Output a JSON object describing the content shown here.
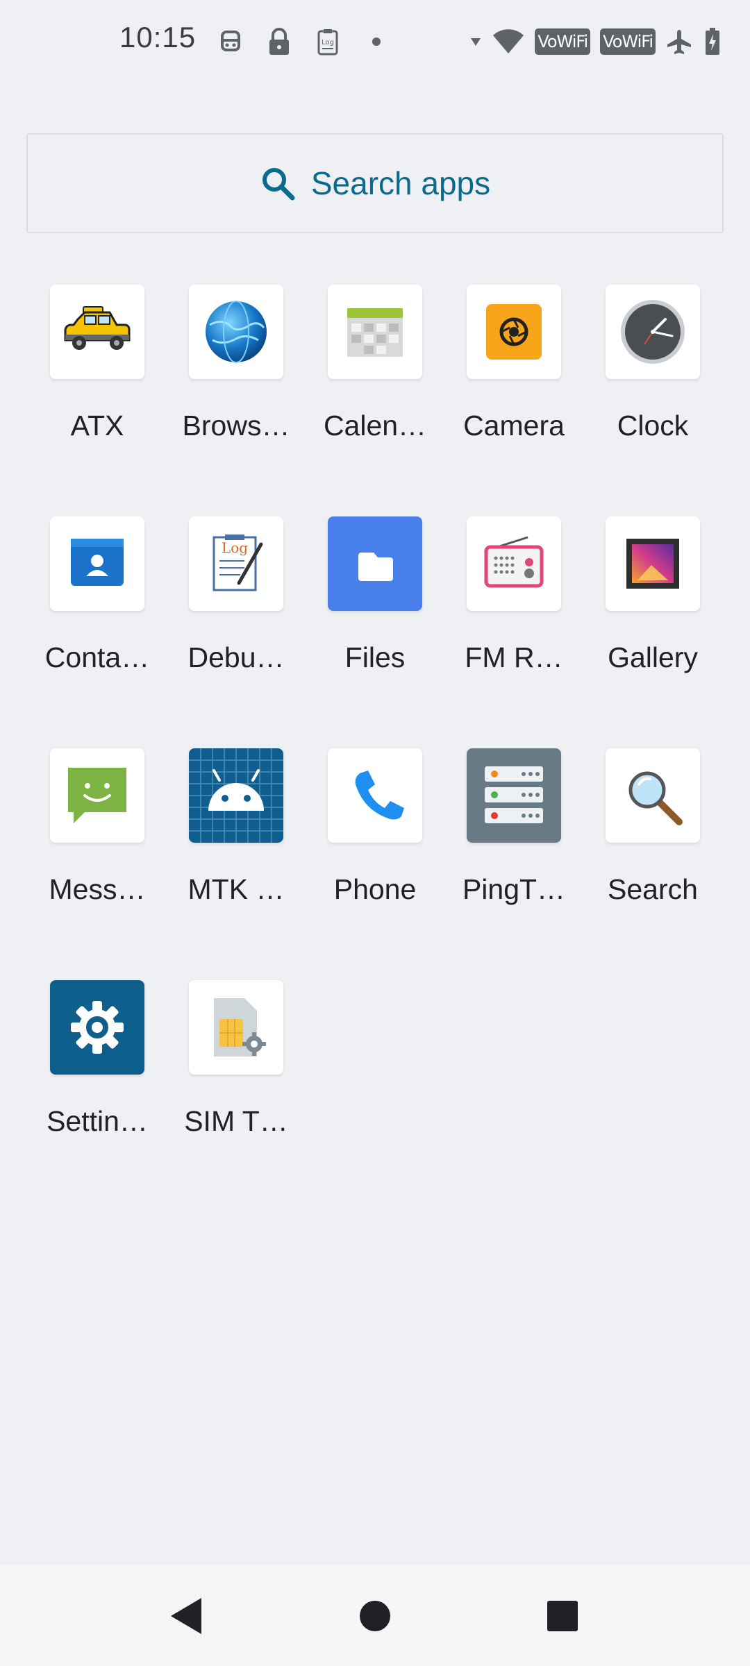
{
  "status_bar": {
    "time": "10:15",
    "left_icons": [
      "robot-icon",
      "lock-icon",
      "clipboard-log-icon",
      "dot-icon"
    ],
    "right_icons": [
      "signal-icon",
      "wifi-icon",
      "vowifi-badge",
      "vowifi-badge",
      "airplane-icon",
      "battery-charging-icon"
    ],
    "vowifi_label_1": "VoWiFi",
    "vowifi_label_2": "VoWiFi"
  },
  "search": {
    "placeholder": "Search apps"
  },
  "apps": [
    {
      "label": "ATX",
      "icon": "taxi-icon"
    },
    {
      "label": "Brows…",
      "icon": "globe-icon"
    },
    {
      "label": "Calen…",
      "icon": "calendar-icon"
    },
    {
      "label": "Camera",
      "icon": "camera-icon"
    },
    {
      "label": "Clock",
      "icon": "clock-icon"
    },
    {
      "label": "Conta…",
      "icon": "contacts-icon"
    },
    {
      "label": "Debu…",
      "icon": "debug-log-icon"
    },
    {
      "label": "Files",
      "icon": "folder-icon"
    },
    {
      "label": "FM R…",
      "icon": "radio-icon"
    },
    {
      "label": "Gallery",
      "icon": "gallery-icon"
    },
    {
      "label": "Mess…",
      "icon": "messaging-icon"
    },
    {
      "label": "MTK …",
      "icon": "android-icon"
    },
    {
      "label": "Phone",
      "icon": "phone-icon"
    },
    {
      "label": "PingT…",
      "icon": "server-icon"
    },
    {
      "label": "Search",
      "icon": "magnifier-icon"
    },
    {
      "label": "Settin…",
      "icon": "settings-gear-icon"
    },
    {
      "label": "SIM T…",
      "icon": "sim-toolkit-icon"
    }
  ],
  "nav_bar": {
    "buttons": [
      "back-icon",
      "home-icon",
      "recents-icon"
    ]
  },
  "colors": {
    "background": "#eff0f3",
    "search_accent": "#0b6b8e",
    "nav_background": "#f4f5f7"
  }
}
